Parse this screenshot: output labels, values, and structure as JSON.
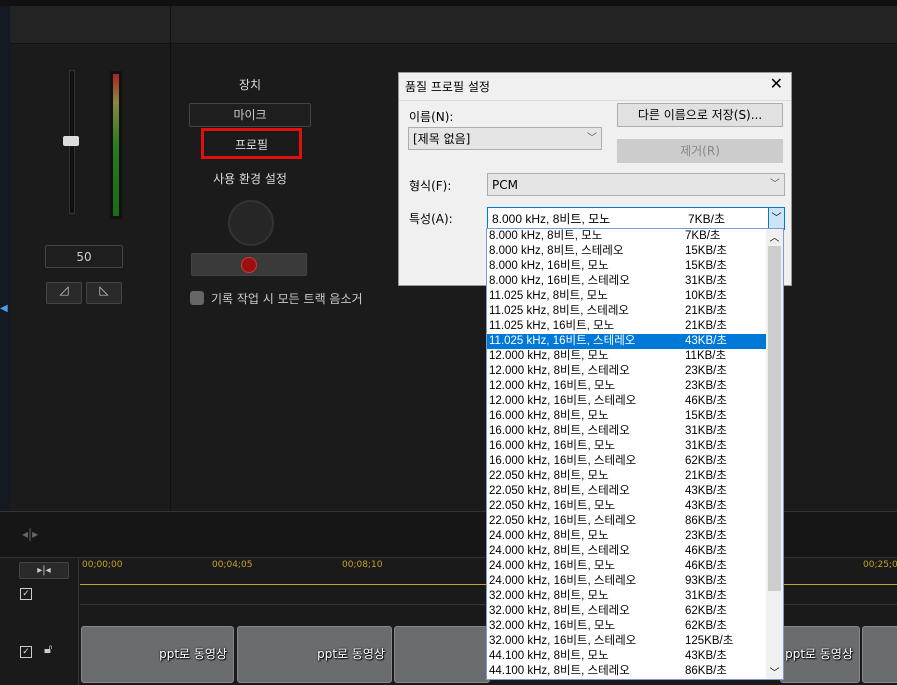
{
  "mixer": {
    "volume_value": "50"
  },
  "record": {
    "device_label": "장치",
    "mic_button": "마이크",
    "profile_button": "프로필",
    "prefs_label": "사용 환경 설정",
    "mute_all_label": "기록 작업 시 모든 트랙 음소거"
  },
  "dialog": {
    "title": "품질 프로필 설정",
    "name_label": "이름(N):",
    "name_value": "[제목 없음]",
    "save_as_button": "다른 이름으로 저장(S)...",
    "remove_button": "제거(R)",
    "format_label": "형식(F):",
    "format_value": "PCM",
    "attr_label": "특성(A):",
    "attr_value": "8.000 kHz, 8비트, 모노",
    "attr_rate": "7KB/초",
    "options": [
      [
        "8.000 kHz, 8비트, 모노",
        "7KB/초"
      ],
      [
        "8.000 kHz, 8비트, 스테레오",
        "15KB/초"
      ],
      [
        "8.000 kHz, 16비트, 모노",
        "15KB/초"
      ],
      [
        "8.000 kHz, 16비트, 스테레오",
        "31KB/초"
      ],
      [
        "11.025 kHz, 8비트, 모노",
        "10KB/초"
      ],
      [
        "11.025 kHz, 8비트, 스테레오",
        "21KB/초"
      ],
      [
        "11.025 kHz, 16비트, 모노",
        "21KB/초"
      ],
      [
        "11.025 kHz, 16비트, 스테레오",
        "43KB/초"
      ],
      [
        "12.000 kHz, 8비트, 모노",
        "11KB/초"
      ],
      [
        "12.000 kHz, 8비트, 스테레오",
        "23KB/초"
      ],
      [
        "12.000 kHz, 16비트, 모노",
        "23KB/초"
      ],
      [
        "12.000 kHz, 16비트, 스테레오",
        "46KB/초"
      ],
      [
        "16.000 kHz, 8비트, 모노",
        "15KB/초"
      ],
      [
        "16.000 kHz, 8비트, 스테레오",
        "31KB/초"
      ],
      [
        "16.000 kHz, 16비트, 모노",
        "31KB/초"
      ],
      [
        "16.000 kHz, 16비트, 스테레오",
        "62KB/초"
      ],
      [
        "22.050 kHz, 8비트, 모노",
        "21KB/초"
      ],
      [
        "22.050 kHz, 8비트, 스테레오",
        "43KB/초"
      ],
      [
        "22.050 kHz, 16비트, 모노",
        "43KB/초"
      ],
      [
        "22.050 kHz, 16비트, 스테레오",
        "86KB/초"
      ],
      [
        "24.000 kHz, 8비트, 모노",
        "23KB/초"
      ],
      [
        "24.000 kHz, 8비트, 스테레오",
        "46KB/초"
      ],
      [
        "24.000 kHz, 16비트, 모노",
        "46KB/초"
      ],
      [
        "24.000 kHz, 16비트, 스테레오",
        "93KB/초"
      ],
      [
        "32.000 kHz, 8비트, 모노",
        "31KB/초"
      ],
      [
        "32.000 kHz, 8비트, 스테레오",
        "62KB/초"
      ],
      [
        "32.000 kHz, 16비트, 모노",
        "62KB/초"
      ],
      [
        "32.000 kHz, 16비트, 스테레오",
        "125KB/초"
      ],
      [
        "44.100 kHz, 8비트, 모노",
        "43KB/초"
      ],
      [
        "44.100 kHz, 8비트, 스테레오",
        "86KB/초"
      ]
    ],
    "selected_index": 7
  },
  "timeline": {
    "ticks": [
      "00;00;00",
      "00;04;05",
      "00;08;10",
      "00;25;0"
    ],
    "clip_title": "ppt로 동영상"
  }
}
